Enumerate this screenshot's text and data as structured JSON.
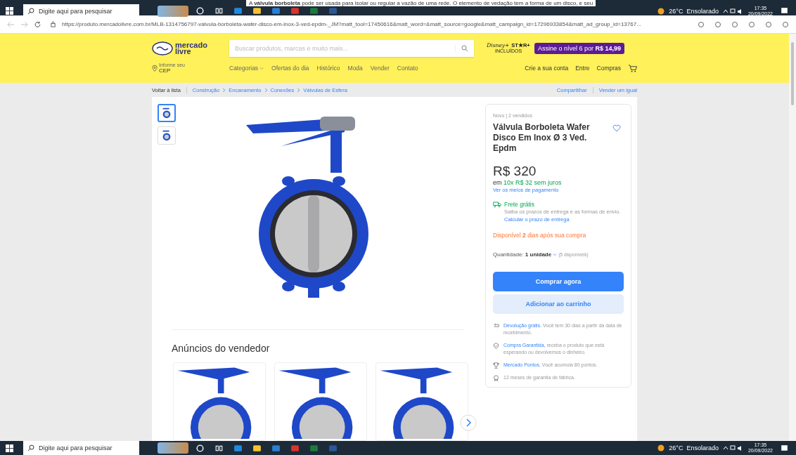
{
  "overlay_text": "A **válvula borboleta** pode ser usada para isolar ou regular a vazão de uma rede. O elemento de vedação tem a forma de um disco, e seu",
  "taskbars": [
    {
      "search_placeholder": "Digite aqui para pesquisar",
      "weather": "26°C  Ensolarado",
      "time": "17:35",
      "date": "20/09/2022"
    },
    {
      "search_placeholder": "Digite aqui para pesquisar",
      "weather": "26°C  Ensolarado",
      "time": "17:35",
      "date": "20/09/2022"
    }
  ],
  "browser": {
    "url": "https://produto.mercadolivre.com.br/MLB-1314756797-valvula-borboleta-wafer-disco-em-inox-3-ved-epdm-_JM?matt_tool=17450616&matt_word=&matt_source=google&matt_campaign_id=17296933854&matt_ad_group_id=13767..."
  },
  "header": {
    "logo_lines": [
      "mercado",
      "livre"
    ],
    "search_placeholder": "Buscar produtos, marcas e muito mais...",
    "promo_logo": [
      "Disney+",
      "ST★R+",
      "INCLUÍDOS"
    ],
    "subscribe": "Assine o nível 6 por **R$ 14,99**",
    "location": [
      "Informe seu",
      "CEP"
    ],
    "nav": [
      {
        "label": "Categorias",
        "dropdown": true
      },
      {
        "label": "Ofertas do dia",
        "dropdown": false
      },
      {
        "label": "Histórico",
        "dropdown": false
      },
      {
        "label": "Moda",
        "dropdown": false
      },
      {
        "label": "Vender",
        "dropdown": false
      },
      {
        "label": "Contato",
        "dropdown": false
      }
    ],
    "account": [
      "Crie a sua conta",
      "Entre",
      "Compras"
    ]
  },
  "breadcrumb": {
    "back": "Voltar à lista",
    "crumbs": [
      "Construção",
      "Encanamento",
      "Conexões",
      "Válvulas de Esfera"
    ],
    "actions": [
      "Compartilhar",
      "Vender um igual"
    ]
  },
  "gallery": {
    "thumbnails": [
      {
        "selected": true
      },
      {
        "selected": false
      }
    ]
  },
  "seller_ads": {
    "title": "Anúncios do vendedor"
  },
  "buy_box": {
    "condition": "Novo | 2 vendidos",
    "title": "Válvula Borboleta Wafer Disco Em Inox Ø 3 Ved. Epdm",
    "favorite": false,
    "price": "R$ 320",
    "installments_prefix": "em",
    "installments": "10x R$ 32 sem juros",
    "payment_link": "Ver os meios de pagamento",
    "shipping": {
      "title": "Frete grátis",
      "text": "Saiba os prazos de entrega e as formas de envio.",
      "link": "Calcular o prazo de entrega"
    },
    "availability": "Disponível **2** dias após sua compra",
    "quantity": {
      "label": "Quantidade:",
      "value": "1 unidade",
      "available": "(5 disponíveis)"
    },
    "buttons": [
      {
        "label": "Comprar agora",
        "kind": "primary"
      },
      {
        "label": "Adicionar ao carrinho",
        "kind": "secondary"
      }
    ],
    "benefits": [
      {
        "kind": "return",
        "link": "Devolução grátis.",
        "text": "Você tem 30 dias a partir da data de recebimento."
      },
      {
        "kind": "shield",
        "link": "Compra Garantida,",
        "text": "receba o produto que está esperando ou devolvemos o dinheiro."
      },
      {
        "kind": "trophy",
        "link": "Mercado Pontos.",
        "text": "Você acumula 80 pontos."
      },
      {
        "kind": "medal",
        "text": "12 meses de garantia de fábrica."
      }
    ]
  }
}
